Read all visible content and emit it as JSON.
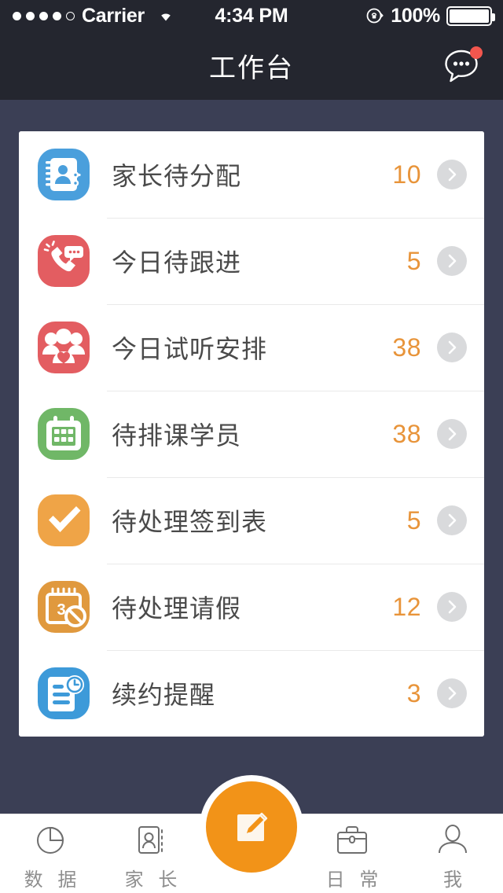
{
  "status_bar": {
    "signal_dots_filled": 4,
    "signal_dots_total": 5,
    "carrier": "Carrier",
    "wifi_icon": "wifi-icon",
    "time": "4:34 PM",
    "lock_icon": "rotation-lock-icon",
    "battery_percent": "100%",
    "battery_icon": "battery-full-icon"
  },
  "navbar": {
    "title": "工作台",
    "action_icon": "message-bubble-icon",
    "badge_color": "#f2564e",
    "has_badge": true
  },
  "theme": {
    "header_bg": "#24262f",
    "page_bg": "#3b3f55",
    "card_bg": "#ffffff",
    "count_color": "#e8943a",
    "accent": "#f29318",
    "label_color": "#4a4a4a",
    "tab_label_color": "#8e8e8e"
  },
  "list": {
    "items": [
      {
        "icon": "address-book-link-icon",
        "icon_bg": "#4a9fdc",
        "label": "家长待分配",
        "count": "10"
      },
      {
        "icon": "phone-call-chat-icon",
        "icon_bg": "#e35d61",
        "label": "今日待跟进",
        "count": "5"
      },
      {
        "icon": "group-heart-icon",
        "icon_bg": "#e35d61",
        "label": "今日试听安排",
        "count": "38"
      },
      {
        "icon": "calendar-grid-icon",
        "icon_bg": "#70b767",
        "label": "待排课学员",
        "count": "38"
      },
      {
        "icon": "check-mark-icon",
        "icon_bg": "#efa447",
        "label": "待处理签到表",
        "count": "5"
      },
      {
        "icon": "calendar-ban-icon",
        "icon_bg": "#e0993e",
        "label": "待处理请假",
        "count": "12"
      },
      {
        "icon": "document-clock-icon",
        "icon_bg": "#3d9ad9",
        "label": "续约提醒",
        "count": "3"
      }
    ],
    "chevron_icon": "chevron-right-icon"
  },
  "tabbar": {
    "tabs": [
      {
        "icon": "pie-chart-icon",
        "label": "数 据",
        "active": false
      },
      {
        "icon": "contact-card-icon",
        "label": "家 长",
        "active": false
      },
      {
        "icon": "compose-icon",
        "label": "",
        "active": true
      },
      {
        "icon": "briefcase-icon",
        "label": "日 常",
        "active": false
      },
      {
        "icon": "person-icon",
        "label": "我",
        "active": false
      }
    ]
  }
}
